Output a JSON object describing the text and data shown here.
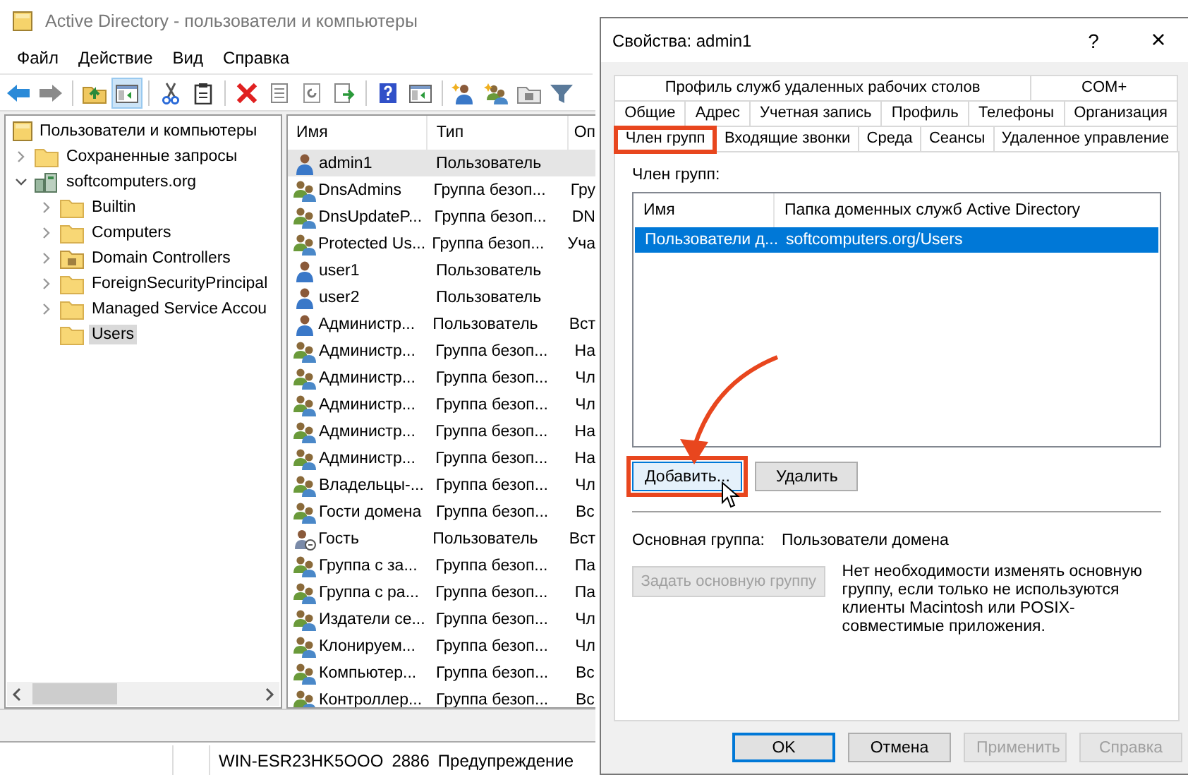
{
  "main_window": {
    "title": "Active Directory - пользователи и компьютеры",
    "menu": [
      "Файл",
      "Действие",
      "Вид",
      "Справка"
    ],
    "toolbar": [
      {
        "kind": "back",
        "pressed": false
      },
      {
        "kind": "forward",
        "pressed": false
      },
      {
        "kind": "sep"
      },
      {
        "kind": "up",
        "pressed": false
      },
      {
        "kind": "tree",
        "pressed": true
      },
      {
        "kind": "sep"
      },
      {
        "kind": "cut",
        "pressed": false
      },
      {
        "kind": "paste",
        "pressed": false
      },
      {
        "kind": "sep"
      },
      {
        "kind": "delete",
        "pressed": false
      },
      {
        "kind": "props",
        "pressed": false
      },
      {
        "kind": "refresh",
        "pressed": false
      },
      {
        "kind": "export",
        "pressed": false
      },
      {
        "kind": "sep"
      },
      {
        "kind": "help",
        "pressed": false
      },
      {
        "kind": "tree",
        "pressed": false
      },
      {
        "kind": "sep"
      },
      {
        "kind": "newuser",
        "pressed": false
      },
      {
        "kind": "newgroup",
        "pressed": false
      },
      {
        "kind": "newou",
        "pressed": false
      },
      {
        "kind": "filter",
        "pressed": false
      }
    ],
    "tree": {
      "label": "Пользователи и компьютеры",
      "kind": "console",
      "children": [
        {
          "label": "Сохраненные запросы",
          "kind": "folder",
          "expanded": false,
          "selected": false
        },
        {
          "label": "softcomputers.org",
          "kind": "domain",
          "expanded": true,
          "selected": false,
          "children": [
            {
              "label": "Builtin",
              "kind": "folder",
              "expanded": false,
              "selected": false
            },
            {
              "label": "Computers",
              "kind": "folder",
              "expanded": false,
              "selected": false
            },
            {
              "label": "Domain Controllers",
              "kind": "ou",
              "expanded": false,
              "selected": false
            },
            {
              "label": "ForeignSecurityPrincipal",
              "kind": "folder",
              "expanded": false,
              "selected": false
            },
            {
              "label": "Managed Service Accou",
              "kind": "folder",
              "expanded": false,
              "selected": false
            },
            {
              "label": "Users",
              "kind": "folder",
              "selected": true
            }
          ]
        }
      ]
    },
    "list": {
      "columns": [
        "Имя",
        "Тип",
        "Оп"
      ],
      "rows": [
        {
          "kind": "user",
          "name": "admin1",
          "type": "Пользователь",
          "column_3": "",
          "selected": true
        },
        {
          "kind": "group",
          "name": "DnsAdmins",
          "type": "Группа безоп...",
          "column_3": "Гру",
          "selected": false
        },
        {
          "kind": "group",
          "name": "DnsUpdateP...",
          "type": "Группа безоп...",
          "column_3": "DN",
          "selected": false
        },
        {
          "kind": "group",
          "name": "Protected Us...",
          "type": "Группа безоп...",
          "column_3": "Уча",
          "selected": false
        },
        {
          "kind": "user",
          "name": "user1",
          "type": "Пользователь",
          "column_3": "",
          "selected": false
        },
        {
          "kind": "user",
          "name": "user2",
          "type": "Пользователь",
          "column_3": "",
          "selected": false
        },
        {
          "kind": "user",
          "name": "Администр...",
          "type": "Пользователь",
          "column_3": "Вст",
          "selected": false
        },
        {
          "kind": "group",
          "name": "Администр...",
          "type": "Группа безоп...",
          "column_3": "На",
          "selected": false
        },
        {
          "kind": "group",
          "name": "Администр...",
          "type": "Группа безоп...",
          "column_3": "Чл",
          "selected": false
        },
        {
          "kind": "group",
          "name": "Администр...",
          "type": "Группа безоп...",
          "column_3": "Чл",
          "selected": false
        },
        {
          "kind": "group",
          "name": "Администр...",
          "type": "Группа безоп...",
          "column_3": "На",
          "selected": false
        },
        {
          "kind": "group",
          "name": "Администр...",
          "type": "Группа безоп...",
          "column_3": "На",
          "selected": false
        },
        {
          "kind": "group",
          "name": "Владельцы-...",
          "type": "Группа безоп...",
          "column_3": "Чл",
          "selected": false
        },
        {
          "kind": "group",
          "name": "Гости домена",
          "type": "Группа безоп...",
          "column_3": "Вс",
          "selected": false
        },
        {
          "kind": "guest",
          "name": "Гость",
          "type": "Пользователь",
          "column_3": "Вст",
          "selected": false
        },
        {
          "kind": "group",
          "name": "Группа с за...",
          "type": "Группа безоп...",
          "column_3": "Па",
          "selected": false
        },
        {
          "kind": "group",
          "name": "Группа с ра...",
          "type": "Группа безоп...",
          "column_3": "Па",
          "selected": false
        },
        {
          "kind": "group",
          "name": "Издатели се...",
          "type": "Группа безоп...",
          "column_3": "Чл",
          "selected": false
        },
        {
          "kind": "group",
          "name": "Клонируем...",
          "type": "Группа безоп...",
          "column_3": "Чл",
          "selected": false
        },
        {
          "kind": "group",
          "name": "Компьютер...",
          "type": "Группа безоп...",
          "column_3": "Вс",
          "selected": false
        },
        {
          "kind": "group",
          "name": "Контроллер...",
          "type": "Группа безоп...",
          "column_3": "Вс",
          "selected": false
        }
      ]
    }
  },
  "background_window": {
    "cells": [
      "WIN-ESR23HK5OOO",
      "2886",
      "Предупреждение"
    ]
  },
  "dialog": {
    "title": "Свойства: admin1",
    "help": "?",
    "close": "×",
    "tab_rows": [
      [
        {
          "label": "Профиль служб удаленных рабочих столов",
          "selected": false,
          "highlighted": false
        },
        {
          "label": "COM+",
          "selected": false,
          "highlighted": false
        }
      ],
      [
        {
          "label": "Общие",
          "selected": false,
          "highlighted": false
        },
        {
          "label": "Адрес",
          "selected": false,
          "highlighted": false
        },
        {
          "label": "Учетная запись",
          "selected": false,
          "highlighted": false
        },
        {
          "label": "Профиль",
          "selected": false,
          "highlighted": false
        },
        {
          "label": "Телефоны",
          "selected": false,
          "highlighted": false
        },
        {
          "label": "Организация",
          "selected": false,
          "highlighted": false
        }
      ],
      [
        {
          "label": "Член групп",
          "selected": true,
          "highlighted": true
        },
        {
          "label": "Входящие звонки",
          "selected": false,
          "highlighted": false
        },
        {
          "label": "Среда",
          "selected": false,
          "highlighted": false
        },
        {
          "label": "Сеансы",
          "selected": false,
          "highlighted": false
        },
        {
          "label": "Удаленное управление",
          "selected": false,
          "highlighted": false
        }
      ]
    ],
    "members_label": "Член групп:",
    "members": {
      "columns": [
        "Имя",
        "Папка доменных служб Active Directory"
      ],
      "rows": [
        {
          "name": "Пользователи д...",
          "folder": "softcomputers.org/Users",
          "selected": true
        }
      ]
    },
    "member_buttons": [
      {
        "label": "Добавить...",
        "highlighted": true,
        "disabled": false
      },
      {
        "label": "Удалить",
        "highlighted": false,
        "disabled": false
      }
    ],
    "primary_group_label": "Основная группа:",
    "primary_group": "Пользователи домена",
    "set_primary_button": {
      "label": "Задать основную группу",
      "disabled": true
    },
    "note": "Нет необходимости изменять основную группу, если только не используются клиенты Macintosh или POSIX-совместимые приложения.",
    "buttons": [
      {
        "label": "OK",
        "default": true,
        "disabled": false
      },
      {
        "label": "Отмена",
        "default": false,
        "disabled": false
      },
      {
        "label": "Применить",
        "default": false,
        "disabled": true
      },
      {
        "label": "Справка",
        "default": false,
        "disabled": true
      }
    ]
  }
}
